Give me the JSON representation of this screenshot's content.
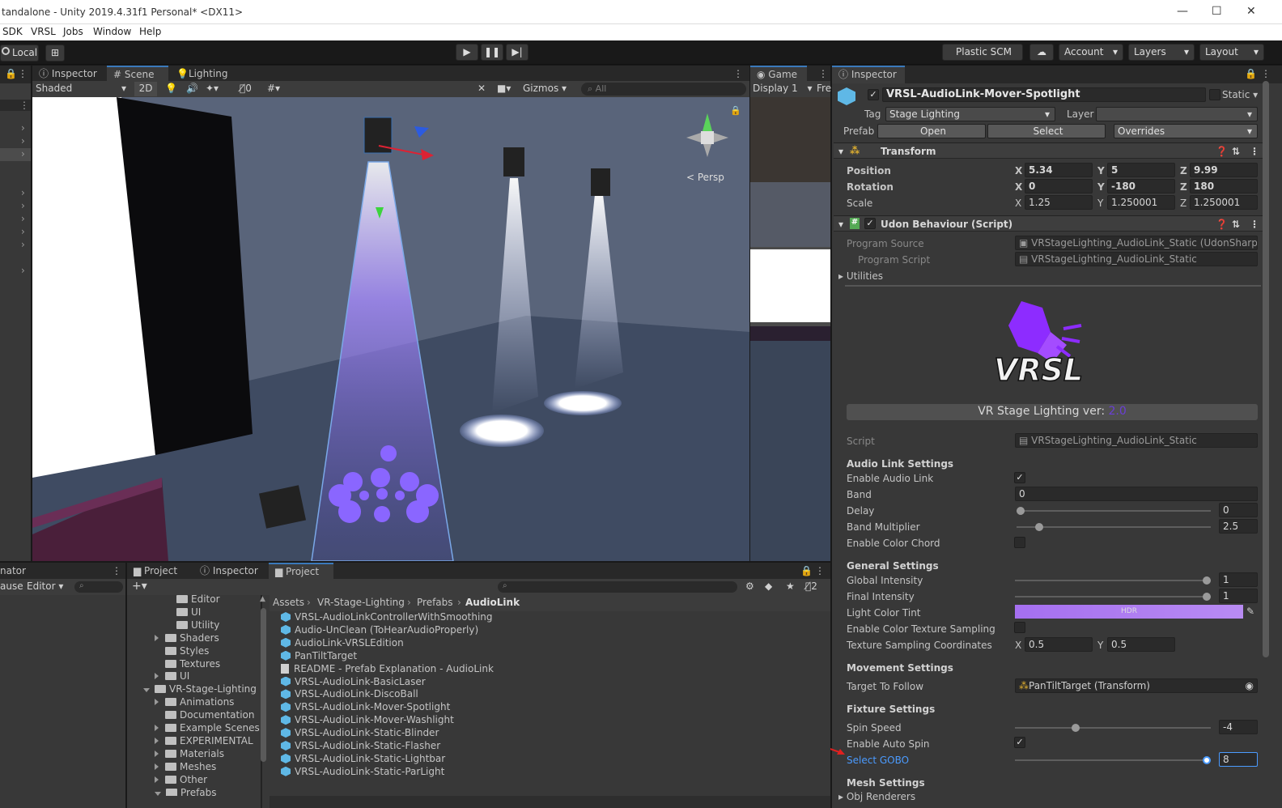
{
  "window": {
    "title": "tandalone - Unity 2019.4.31f1 Personal* <DX11>"
  },
  "menu": [
    "SDK",
    "VRSL",
    "Jobs",
    "Window",
    "Help"
  ],
  "toolbar": {
    "local": "Local",
    "plastic": "Plastic SCM",
    "account": "Account",
    "layers": "Layers",
    "layout": "Layout"
  },
  "scene_tabs": {
    "inspector": "Inspector",
    "scene": "Scene",
    "lighting": "Lighting"
  },
  "scene_toolbar": {
    "shading": "Shaded",
    "mode2d": "2D",
    "hidden_count": "0",
    "gizmos": "Gizmos",
    "search_placeholder": "All",
    "persp": "< Persp"
  },
  "game": {
    "tab": "Game",
    "display": "Display 1",
    "free": "Fre"
  },
  "inspector": {
    "tab": "Inspector",
    "object_name": "VRSL-AudioLink-Mover-Spotlight",
    "static_label": "Static",
    "tag_label": "Tag",
    "tag_value": "Stage Lighting",
    "layer_label": "Layer",
    "prefab_label": "Prefab",
    "open": "Open",
    "select": "Select",
    "overrides": "Overrides",
    "transform": {
      "header": "Transform",
      "position_label": "Position",
      "position": {
        "x": "5.34",
        "y": "5",
        "z": "9.99"
      },
      "rotation_label": "Rotation",
      "rotation": {
        "x": "0",
        "y": "-180",
        "z": "180"
      },
      "scale_label": "Scale",
      "scale": {
        "x": "1.25",
        "y": "1.250001",
        "z": "1.250001"
      }
    },
    "udon": {
      "header": "Udon Behaviour (Script)",
      "program_source_label": "Program Source",
      "program_source": "VRStageLighting_AudioLink_Static (UdonSharpP",
      "program_script_label": "Program Script",
      "program_script": "VRStageLighting_AudioLink_Static",
      "utilities": "Utilities"
    },
    "logo_text": "VRSL",
    "version_label": "VR Stage Lighting ver:",
    "version_value": "2.0",
    "script_label": "Script",
    "script_value": "VRStageLighting_AudioLink_Static",
    "audio_link": {
      "title": "Audio Link Settings",
      "enable": "Enable Audio Link",
      "band": "Band",
      "band_value": "0",
      "delay": "Delay",
      "delay_value": "0",
      "band_multiplier": "Band Multiplier",
      "band_multiplier_value": "2.5",
      "color_chord": "Enable Color Chord"
    },
    "general": {
      "title": "General Settings",
      "global_intensity": "Global Intensity",
      "global_intensity_value": "1",
      "final_intensity": "Final Intensity",
      "final_intensity_value": "1",
      "light_color_tint": "Light Color Tint",
      "hdr": "HDR",
      "color_texture": "Enable Color Texture Sampling",
      "texture_coords": "Texture Sampling Coordinates",
      "tex_x": "0.5",
      "tex_y": "0.5"
    },
    "movement": {
      "title": "Movement Settings",
      "target": "Target To Follow",
      "target_value": "PanTiltTarget (Transform)"
    },
    "fixture": {
      "title": "Fixture Settings",
      "spin_speed": "Spin Speed",
      "spin_speed_value": "-4",
      "auto_spin": "Enable Auto Spin",
      "gobo": "Select GOBO",
      "gobo_value": "8"
    },
    "mesh": {
      "title": "Mesh Settings",
      "obj_renderers": "Obj Renderers"
    }
  },
  "bottom": {
    "animator_tab": "nator",
    "pause": "ause",
    "editor": "Editor",
    "tabs": {
      "project1": "Project",
      "inspector": "Inspector",
      "project2": "Project"
    },
    "hidden_count": "2",
    "breadcrumb": [
      "Assets",
      "VR-Stage-Lighting",
      "Prefabs",
      "AudioLink"
    ],
    "tree": [
      {
        "label": "Editor",
        "indent": 2,
        "arrow": ""
      },
      {
        "label": "UI",
        "indent": 2,
        "arrow": ""
      },
      {
        "label": "Utility",
        "indent": 2,
        "arrow": ""
      },
      {
        "label": "Shaders",
        "indent": 1,
        "arrow": "r"
      },
      {
        "label": "Styles",
        "indent": 1,
        "arrow": ""
      },
      {
        "label": "Textures",
        "indent": 1,
        "arrow": ""
      },
      {
        "label": "UI",
        "indent": 1,
        "arrow": "r"
      },
      {
        "label": "VR-Stage-Lighting",
        "indent": 0,
        "arrow": "d"
      },
      {
        "label": "Animations",
        "indent": 1,
        "arrow": "r"
      },
      {
        "label": "Documentation",
        "indent": 1,
        "arrow": ""
      },
      {
        "label": "Example Scenes",
        "indent": 1,
        "arrow": "r"
      },
      {
        "label": "EXPERIMENTAL",
        "indent": 1,
        "arrow": "r"
      },
      {
        "label": "Materials",
        "indent": 1,
        "arrow": "r"
      },
      {
        "label": "Meshes",
        "indent": 1,
        "arrow": "r"
      },
      {
        "label": "Other",
        "indent": 1,
        "arrow": "r"
      },
      {
        "label": "Prefabs",
        "indent": 1,
        "arrow": "d"
      }
    ],
    "files": [
      {
        "name": "VRSL-AudioLinkControllerWithSmoothing",
        "type": "cube"
      },
      {
        "name": "Audio-UnClean (ToHearAudioProperly)",
        "type": "cube"
      },
      {
        "name": "AudioLink-VRSLEdition",
        "type": "cube"
      },
      {
        "name": "PanTiltTarget",
        "type": "cube"
      },
      {
        "name": "README - Prefab Explanation - AudioLink",
        "type": "doc"
      },
      {
        "name": "VRSL-AudioLink-BasicLaser",
        "type": "cube"
      },
      {
        "name": "VRSL-AudioLink-DiscoBall",
        "type": "cube"
      },
      {
        "name": "VRSL-AudioLink-Mover-Spotlight",
        "type": "cube"
      },
      {
        "name": "VRSL-AudioLink-Mover-Washlight",
        "type": "cube"
      },
      {
        "name": "VRSL-AudioLink-Static-Blinder",
        "type": "cube"
      },
      {
        "name": "VRSL-AudioLink-Static-Flasher",
        "type": "cube"
      },
      {
        "name": "VRSL-AudioLink-Static-Lightbar",
        "type": "cube"
      },
      {
        "name": "VRSL-AudioLink-Static-ParLight",
        "type": "cube"
      }
    ]
  },
  "colors": {
    "accent": "#3a79bb",
    "version": "#6a3fd6",
    "gobo_label": "#4b9bff",
    "hdr_tint": "#b07aee"
  },
  "sliders": {
    "delay": 0.0,
    "band_multiplier": 0.1,
    "global_intensity": 1.0,
    "final_intensity": 1.0,
    "spin_speed": 0.3,
    "gobo": 1.0
  }
}
